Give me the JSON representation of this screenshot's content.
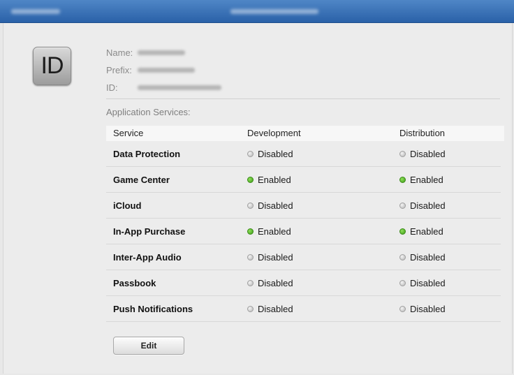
{
  "header": {
    "left_text_redacted": true,
    "center_text_redacted": true
  },
  "app_id": {
    "icon_text": "ID",
    "name_label": "Name:",
    "prefix_label": "Prefix:",
    "id_label": "ID:"
  },
  "services": {
    "title": "Application Services:",
    "columns": [
      "Service",
      "Development",
      "Distribution"
    ],
    "rows": [
      {
        "service": "Data Protection",
        "development": "Disabled",
        "distribution": "Disabled"
      },
      {
        "service": "Game Center",
        "development": "Enabled",
        "distribution": "Enabled"
      },
      {
        "service": "iCloud",
        "development": "Disabled",
        "distribution": "Disabled"
      },
      {
        "service": "In-App Purchase",
        "development": "Enabled",
        "distribution": "Enabled"
      },
      {
        "service": "Inter-App Audio",
        "development": "Disabled",
        "distribution": "Disabled"
      },
      {
        "service": "Passbook",
        "development": "Disabled",
        "distribution": "Disabled"
      },
      {
        "service": "Push Notifications",
        "development": "Disabled",
        "distribution": "Disabled"
      }
    ]
  },
  "actions": {
    "edit_label": "Edit"
  },
  "colors": {
    "enabled": "#4caf1f",
    "disabled": "#b3b3b3",
    "header": "#2a61a8"
  }
}
